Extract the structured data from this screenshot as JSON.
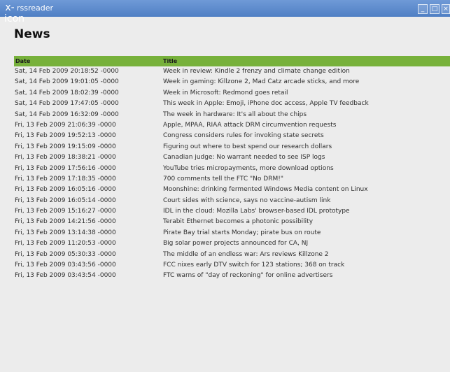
{
  "window": {
    "title": "rssreader",
    "icon": "x-icon",
    "minimize": "_",
    "maximize": "□",
    "close": "×"
  },
  "heading": "News",
  "table": {
    "columns": [
      "Date",
      "Title"
    ],
    "rows": [
      {
        "date": "Sat, 14 Feb 2009 20:18:52 -0000",
        "title": "Week in review: Kindle 2 frenzy and climate change edition"
      },
      {
        "date": "Sat, 14 Feb 2009 19:01:05 -0000",
        "title": "Week in gaming: Killzone 2, Mad Catz arcade sticks, and more"
      },
      {
        "date": "Sat, 14 Feb 2009 18:02:39 -0000",
        "title": "Week in Microsoft: Redmond goes retail"
      },
      {
        "date": "Sat, 14 Feb 2009 17:47:05 -0000",
        "title": "This week in Apple: Emoji, iPhone doc access, Apple TV feedback"
      },
      {
        "date": "Sat, 14 Feb 2009 16:32:09 -0000",
        "title": "The week in hardware: It's all about the chips"
      },
      {
        "date": "Fri, 13 Feb 2009 21:06:39 -0000",
        "title": "Apple, MPAA, RIAA attack DRM circumvention requests"
      },
      {
        "date": "Fri, 13 Feb 2009 19:52:13 -0000",
        "title": "Congress considers rules for invoking state secrets"
      },
      {
        "date": "Fri, 13 Feb 2009 19:15:09 -0000",
        "title": "Figuring out where to best spend our research dollars"
      },
      {
        "date": "Fri, 13 Feb 2009 18:38:21 -0000",
        "title": "Canadian judge: No warrant needed to see ISP logs"
      },
      {
        "date": "Fri, 13 Feb 2009 17:56:16 -0000",
        "title": "YouTube tries micropayments, more download options"
      },
      {
        "date": "Fri, 13 Feb 2009 17:18:35 -0000",
        "title": "700 comments tell the FTC \"No DRM!\""
      },
      {
        "date": "Fri, 13 Feb 2009 16:05:16 -0000",
        "title": "Moonshine: drinking fermented Windows Media content on Linux"
      },
      {
        "date": "Fri, 13 Feb 2009 16:05:14 -0000",
        "title": "Court sides with science, says no vaccine-autism link"
      },
      {
        "date": "Fri, 13 Feb 2009 15:16:27 -0000",
        "title": "IDL in the cloud: Mozilla Labs' browser-based IDL prototype"
      },
      {
        "date": "Fri, 13 Feb 2009 14:21:56 -0000",
        "title": "Terabit Ethernet becomes a photonic possibility"
      },
      {
        "date": "Fri, 13 Feb 2009 13:14:38 -0000",
        "title": "Pirate Bay trial starts Monday; pirate bus on route"
      },
      {
        "date": "Fri, 13 Feb 2009 11:20:53 -0000",
        "title": "Big solar power projects announced for CA, NJ"
      },
      {
        "date": "Fri, 13 Feb 2009 05:30:33 -0000",
        "title": "The middle of an endless war: Ars reviews Killzone 2"
      },
      {
        "date": "Fri, 13 Feb 2009 03:43:56 -0000",
        "title": "FCC nixes early DTV switch for 123 stations; 368 on track"
      },
      {
        "date": "Fri, 13 Feb 2009 03:43:54 -0000",
        "title": "FTC warns of \"day of reckoning\" for online advertisers"
      }
    ]
  }
}
